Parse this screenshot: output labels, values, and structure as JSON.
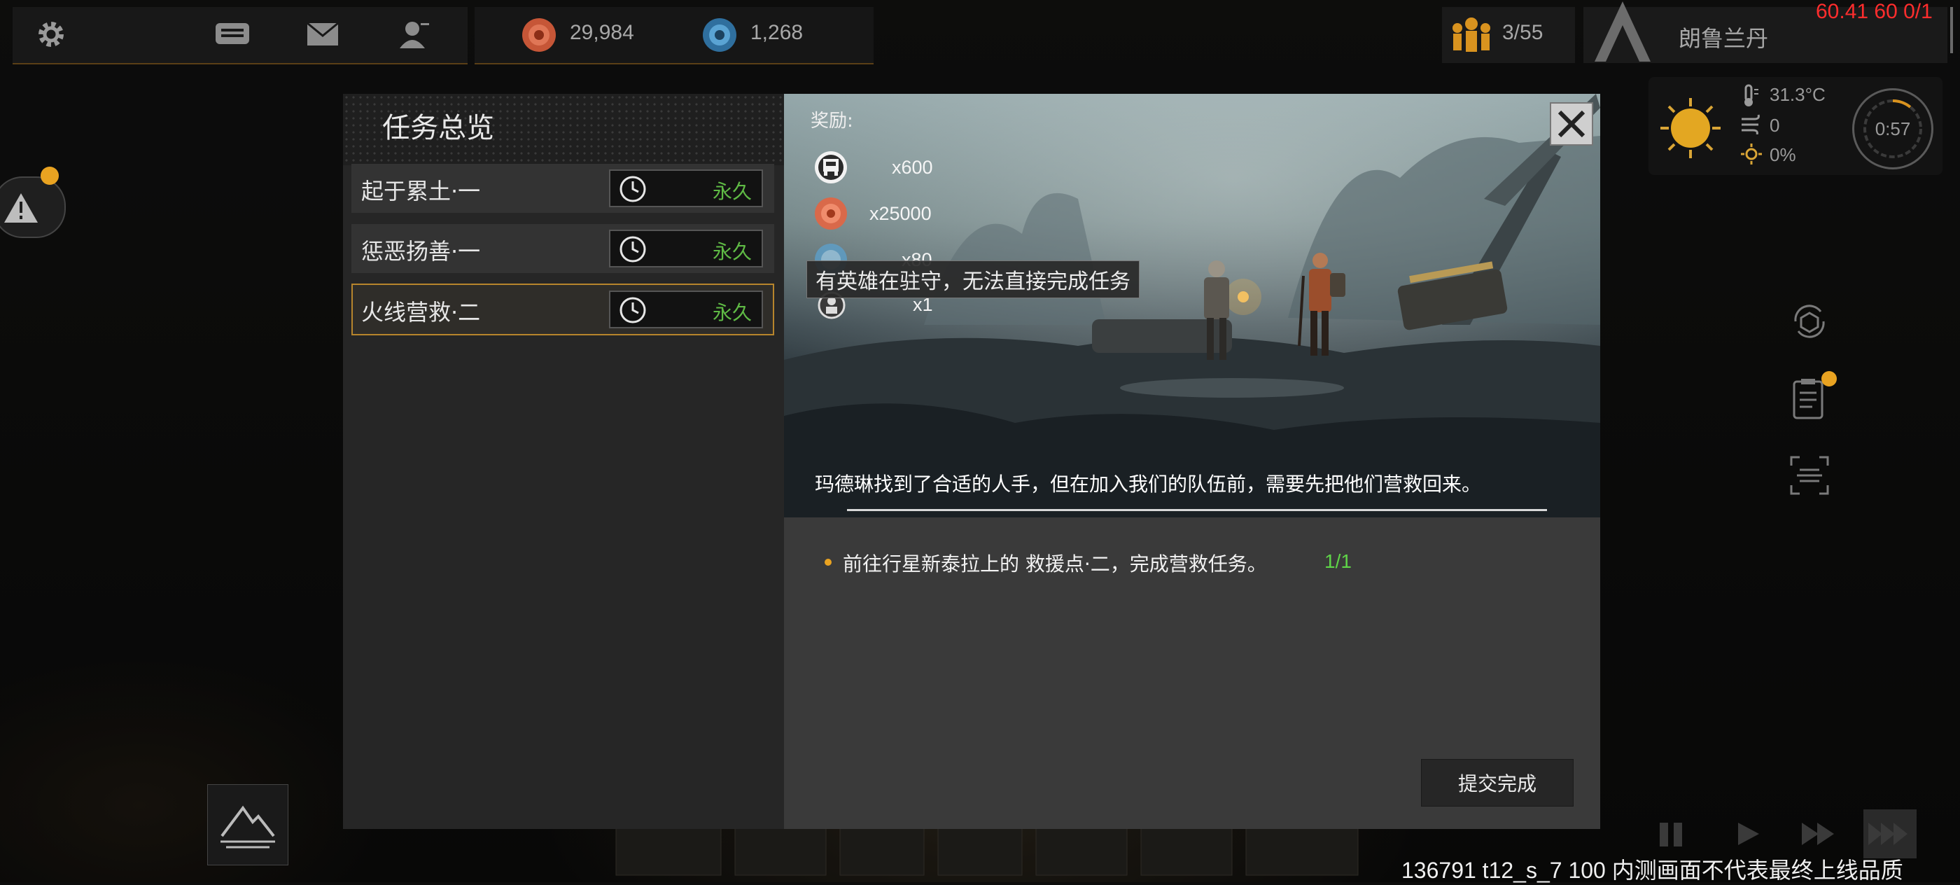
{
  "topbar": {
    "resource_a": "29,984",
    "resource_b": "1,268",
    "population": "3/55",
    "player_name": "朗鲁兰丹",
    "debug_stats": "60.41 60 0/1"
  },
  "weather": {
    "temperature": "31.3°C",
    "wind": "0",
    "humidity": "0%",
    "timer": "0:57"
  },
  "task_panel": {
    "title": "任务总览",
    "tasks": [
      {
        "name": "起于累土·一",
        "duration": "永久"
      },
      {
        "name": "惩恶扬善·一",
        "duration": "永久"
      },
      {
        "name": "火线营救·二",
        "duration": "永久"
      }
    ]
  },
  "detail": {
    "reward_label": "奖励:",
    "rewards": [
      {
        "icon": "cargo-icon",
        "qty": "x600"
      },
      {
        "icon": "mineral-icon",
        "qty": "x25000"
      },
      {
        "icon": "energy-icon",
        "qty": "x80"
      },
      {
        "icon": "hero-card-icon",
        "qty": "x1"
      }
    ],
    "tooltip": "有英雄在驻守，无法直接完成任务",
    "story": "玛德琳找到了合适的人手，但在加入我们的队伍前，需要先把他们营救回来。",
    "objective": "前往行星新泰拉上的 救援点·二，完成营救任务。",
    "objective_progress": "1/1",
    "submit_label": "提交完成"
  },
  "footer": {
    "build_text": "136791 t12_s_7 100 内测画面不代表最终上线品质"
  },
  "colors": {
    "accent_gold": "#e9a321",
    "green": "#5fba45",
    "debug_red": "#ff2d2d"
  }
}
